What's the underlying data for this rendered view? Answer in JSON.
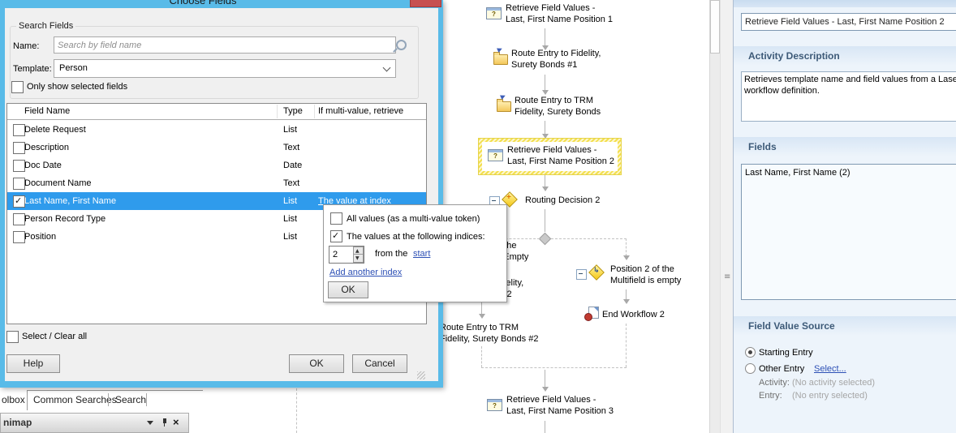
{
  "dialog": {
    "title": "Choose Fields",
    "search": {
      "group_label": "Search Fields",
      "name_label": "Name:",
      "name_placeholder": "Search by field name",
      "template_label": "Template:",
      "template_value": "Person",
      "only_selected_label": "Only show selected fields"
    },
    "fields_table": {
      "columns": [
        "Field Name",
        "Type",
        "If multi-value, retrieve"
      ],
      "rows": [
        {
          "name": "Delete Request",
          "type": "List",
          "retrieve": ""
        },
        {
          "name": "Description",
          "type": "Text",
          "retrieve": ""
        },
        {
          "name": "Doc Date",
          "type": "Date",
          "retrieve": ""
        },
        {
          "name": "Document Name",
          "type": "Text",
          "retrieve": ""
        },
        {
          "name": "Last Name, First Name",
          "type": "List",
          "retrieve": "The value at index"
        },
        {
          "name": "Person Record Type",
          "type": "List",
          "retrieve": ""
        },
        {
          "name": "Position",
          "type": "List",
          "retrieve": ""
        }
      ]
    },
    "select_clear_label": "Select / Clear all",
    "help_button": "Help",
    "ok_button": "OK",
    "cancel_button": "Cancel"
  },
  "index_popup": {
    "all_values_label": "All values (as a multi-value token)",
    "indices_label": "The values at the following indices:",
    "index_value": "2",
    "from_label": "from the",
    "start_link": "start",
    "add_index_link": "Add another index",
    "ok_button": "OK"
  },
  "canvas": {
    "nodes": {
      "rfv1": "Retrieve Field Values -\nLast, First Name Position 1",
      "route_fidelity_1": "Route Entry to Fidelity,\nSurety Bonds #1",
      "route_trm": "Route Entry to TRM\nFidelity, Surety Bonds",
      "rfv2": "Retrieve Field Values -\nLast, First Name Position 2",
      "routing_decision": "Routing Decision 2",
      "branch_not_empty": "Position 2 of the\nMultifield is Not Empty",
      "route_fidelity_2": "Route Entry to Fidelity,\nSurety Bonds #2",
      "route_trm_2": "Route Entry to TRM\nFidelity, Surety Bonds #2",
      "branch_empty": "Position 2 of the\nMultifield is empty",
      "end_workflow": "End Workflow 2",
      "rfv3": "Retrieve Field Values -\nLast, First Name Position 3"
    }
  },
  "bottom_panel": {
    "tabs": [
      "olbox",
      "Common Searches",
      "Search"
    ],
    "minimap_title": "nimap"
  },
  "properties_panel": {
    "activity_name_value": "Retrieve Field Values - Last, First Name Position 2",
    "description_header": "Activity Description",
    "description_text": "Retrieves template name and field values from a Laserfi\nworkflow definition.",
    "fields_header": "Fields",
    "fields_value": "Last Name, First Name (2)",
    "source_header": "Field Value Source",
    "starting_entry_label": "Starting Entry",
    "other_entry_label": "Other Entry",
    "select_link": "Select...",
    "activity_label": "Activity:",
    "activity_value": "(No activity selected)",
    "entry_label": "Entry:",
    "entry_value": "(No entry selected)"
  },
  "colors": {
    "dialog_border": "#59BBE8",
    "close_button": "#C75050",
    "selection_blue": "#2F9BEC",
    "link_blue": "#2D50B5",
    "panel_header_text": "#3D5A78",
    "highlight_yellow": "#F3DF4E"
  }
}
